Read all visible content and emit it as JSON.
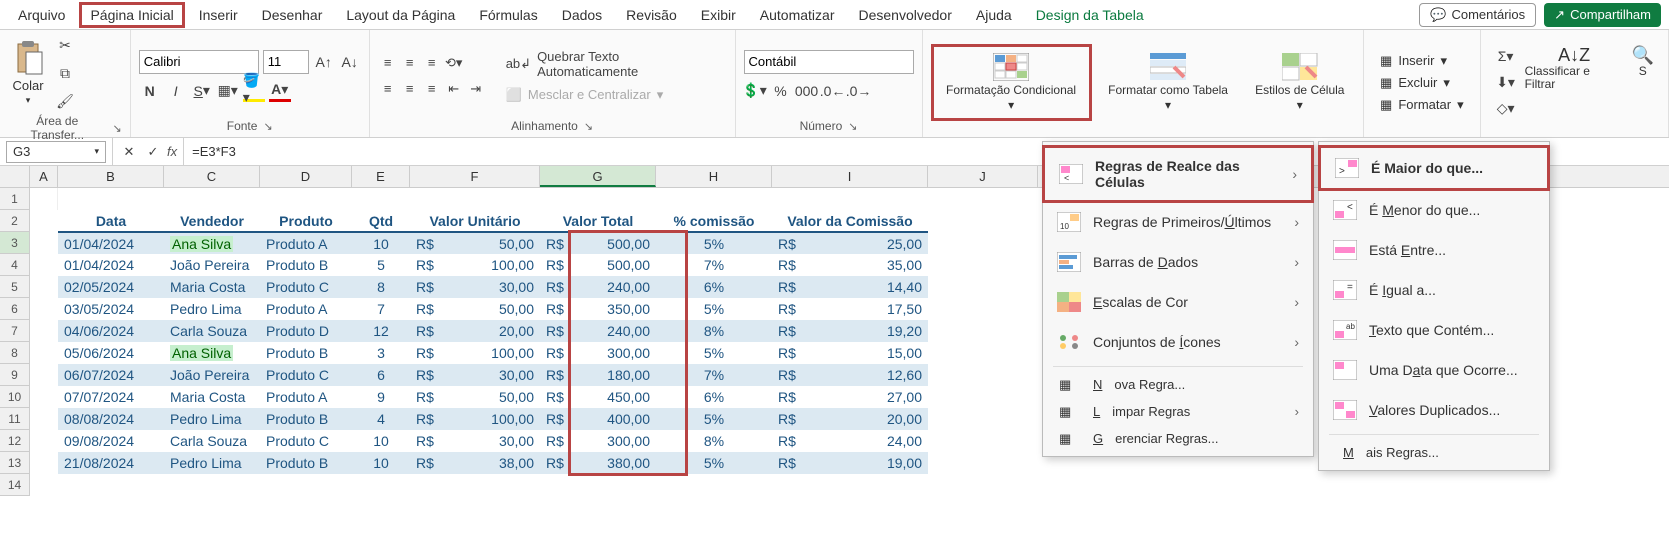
{
  "menu": {
    "items": [
      "Arquivo",
      "Página Inicial",
      "Inserir",
      "Desenhar",
      "Layout da Página",
      "Fórmulas",
      "Dados",
      "Revisão",
      "Exibir",
      "Automatizar",
      "Desenvolvedor",
      "Ajuda",
      "Design da Tabela"
    ],
    "comentarios": "Comentários",
    "compartilhar": "Compartilham"
  },
  "ribbon": {
    "clipboard": {
      "paste": "Colar",
      "label": "Área de Transfer..."
    },
    "font": {
      "name": "Calibri",
      "size": "11",
      "label": "Fonte"
    },
    "alignment": {
      "wrap": "Quebrar Texto Automaticamente",
      "merge": "Mesclar e Centralizar",
      "label": "Alinhamento"
    },
    "number": {
      "format": "Contábil",
      "label": "Número"
    },
    "styles": {
      "cond": "Formatação Condicional",
      "table": "Formatar como Tabela",
      "cell": "Estilos de Célula"
    },
    "cells": {
      "insert": "Inserir",
      "delete": "Excluir",
      "format": "Formatar"
    },
    "editing": {
      "sort": "Classificar e Filtrar",
      "find": "S"
    }
  },
  "formula": {
    "cell": "G3",
    "value": "=E3*F3"
  },
  "columns": [
    "A",
    "B",
    "C",
    "D",
    "E",
    "F",
    "G",
    "H",
    "I",
    "J"
  ],
  "headers": [
    "Data",
    "Vendedor",
    "Produto",
    "Qtd",
    "Valor Unitário",
    "Valor Total",
    "% comissão",
    "Valor da Comissão"
  ],
  "rows": [
    {
      "data": "01/04/2024",
      "vend": "Ana Silva",
      "prod": "Produto A",
      "qtd": "10",
      "unit": "50,00",
      "total": "500,00",
      "pct": "5%",
      "com": "25,00",
      "hl": true
    },
    {
      "data": "01/04/2024",
      "vend": "João Pereira",
      "prod": "Produto B",
      "qtd": "5",
      "unit": "100,00",
      "total": "500,00",
      "pct": "7%",
      "com": "35,00"
    },
    {
      "data": "02/05/2024",
      "vend": "Maria Costa",
      "prod": "Produto C",
      "qtd": "8",
      "unit": "30,00",
      "total": "240,00",
      "pct": "6%",
      "com": "14,40"
    },
    {
      "data": "03/05/2024",
      "vend": "Pedro Lima",
      "prod": "Produto A",
      "qtd": "7",
      "unit": "50,00",
      "total": "350,00",
      "pct": "5%",
      "com": "17,50"
    },
    {
      "data": "04/06/2024",
      "vend": "Carla Souza",
      "prod": "Produto D",
      "qtd": "12",
      "unit": "20,00",
      "total": "240,00",
      "pct": "8%",
      "com": "19,20"
    },
    {
      "data": "05/06/2024",
      "vend": "Ana Silva",
      "prod": "Produto B",
      "qtd": "3",
      "unit": "100,00",
      "total": "300,00",
      "pct": "5%",
      "com": "15,00",
      "hl": true
    },
    {
      "data": "06/07/2024",
      "vend": "João Pereira",
      "prod": "Produto C",
      "qtd": "6",
      "unit": "30,00",
      "total": "180,00",
      "pct": "7%",
      "com": "12,60"
    },
    {
      "data": "07/07/2024",
      "vend": "Maria Costa",
      "prod": "Produto A",
      "qtd": "9",
      "unit": "50,00",
      "total": "450,00",
      "pct": "6%",
      "com": "27,00"
    },
    {
      "data": "08/08/2024",
      "vend": "Pedro Lima",
      "prod": "Produto B",
      "qtd": "4",
      "unit": "100,00",
      "total": "400,00",
      "pct": "5%",
      "com": "20,00"
    },
    {
      "data": "09/08/2024",
      "vend": "Carla Souza",
      "prod": "Produto C",
      "qtd": "10",
      "unit": "30,00",
      "total": "300,00",
      "pct": "8%",
      "com": "24,00"
    },
    {
      "data": "21/08/2024",
      "vend": "Pedro Lima",
      "prod": "Produto B",
      "qtd": "10",
      "unit": "38,00",
      "total": "380,00",
      "pct": "5%",
      "com": "19,00"
    }
  ],
  "currency": "R$",
  "dropdown1": {
    "highlight": "Regras de Realce das Células",
    "top": "Regras de Primeiros/Últimos",
    "bars": "Barras de Dados",
    "scales": "Escalas de Cor",
    "icons": "Conjuntos de Ícones",
    "new": "Nova Regra...",
    "clear": "Limpar Regras",
    "manage": "Gerenciar Regras..."
  },
  "dropdown2": {
    "greater": "É Maior do que...",
    "less": "É Menor do que...",
    "between": "Está Entre...",
    "equal": "É Igual a...",
    "text": "Texto que Contém...",
    "date": "Uma Data que Ocorre...",
    "dup": "Valores Duplicados...",
    "more": "Mais Regras..."
  }
}
